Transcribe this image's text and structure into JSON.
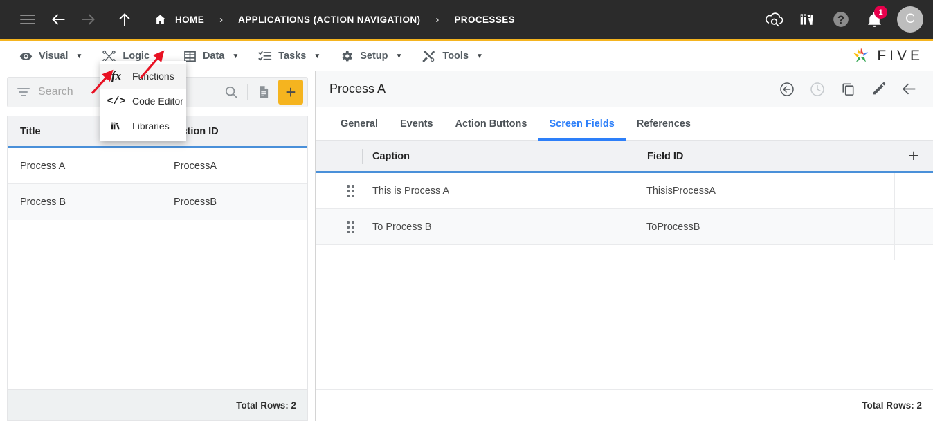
{
  "topbar": {
    "menu_icon": "hamburger-icon",
    "back_icon": "arrow-left-icon",
    "forward_icon": "arrow-right-icon",
    "up_icon": "arrow-up-icon",
    "home_label": "HOME",
    "breadcrumbs": [
      "HOME",
      "APPLICATIONS (ACTION NAVIGATION)",
      "PROCESSES"
    ],
    "separator": "›",
    "crumb_app": "APPLICATIONS (ACTION NAVIGATION)",
    "crumb_page": "PROCESSES",
    "notification_count": "1",
    "avatar_initial": "C",
    "icons": [
      "cloud-search-icon",
      "books-icon",
      "help-icon",
      "bell-icon"
    ],
    "background": "#2b2b2b"
  },
  "menubar": {
    "accent": "#f5b41f",
    "items": [
      {
        "label": "Visual",
        "icon": "eye-icon",
        "caret": "▼"
      },
      {
        "label": "Logic",
        "icon": "nodes-icon",
        "caret": "▼"
      },
      {
        "label": "Data",
        "icon": "grid-icon",
        "caret": "▼"
      },
      {
        "label": "Tasks",
        "icon": "checklist-icon",
        "caret": "▼"
      },
      {
        "label": "Setup",
        "icon": "gear-icon",
        "caret": "▼"
      },
      {
        "label": "Tools",
        "icon": "tools-icon",
        "caret": "▼"
      }
    ],
    "logo_text": "FIVE"
  },
  "dropdown": {
    "open_for": "Logic",
    "items": [
      {
        "label": "Functions",
        "icon": "fx-icon",
        "active": true
      },
      {
        "label": "Code Editor",
        "icon": "code-icon",
        "active": false
      },
      {
        "label": "Libraries",
        "icon": "books-icon",
        "active": false
      }
    ]
  },
  "left_panel": {
    "search": {
      "placeholder": "Search",
      "value": ""
    },
    "toolbar": {
      "filter_icon": "filter-icon",
      "search_icon": "search-icon",
      "report_icon": "document-icon",
      "add_label": "+",
      "add_color": "#f5b41f"
    },
    "table": {
      "columns": [
        "Title",
        "Action ID"
      ],
      "rows": [
        {
          "title": "Process A",
          "action_id": "ProcessA"
        },
        {
          "title": "Process B",
          "action_id": "ProcessB"
        }
      ]
    },
    "footer": {
      "total_rows": "Total Rows: 2"
    }
  },
  "right_panel": {
    "title": "Process A",
    "header_icons": [
      "undo-circle-icon",
      "history-clock-icon",
      "copy-icon",
      "edit-pencil-icon",
      "back-arrow-icon"
    ],
    "tabs": [
      {
        "label": "General",
        "active": false
      },
      {
        "label": "Events",
        "active": false
      },
      {
        "label": "Action Buttons",
        "active": false
      },
      {
        "label": "Screen Fields",
        "active": true
      },
      {
        "label": "References",
        "active": false
      }
    ],
    "active_tab_color": "#2d7ff9",
    "table": {
      "columns": [
        "Caption",
        "Field ID"
      ],
      "add_label": "+",
      "rows": [
        {
          "caption": "This is Process A",
          "field_id": "ThisisProcessA"
        },
        {
          "caption": "To Process B",
          "field_id": "ToProcessB"
        }
      ]
    },
    "footer": {
      "total_rows": "Total Rows: 2"
    }
  },
  "annotations": {
    "arrow_color": "#e81123",
    "arrows": [
      {
        "name": "arrow-to-logic-caret",
        "points_at": "Logic dropdown caret"
      },
      {
        "name": "arrow-to-functions-item",
        "points_at": "Functions menu item"
      }
    ]
  }
}
